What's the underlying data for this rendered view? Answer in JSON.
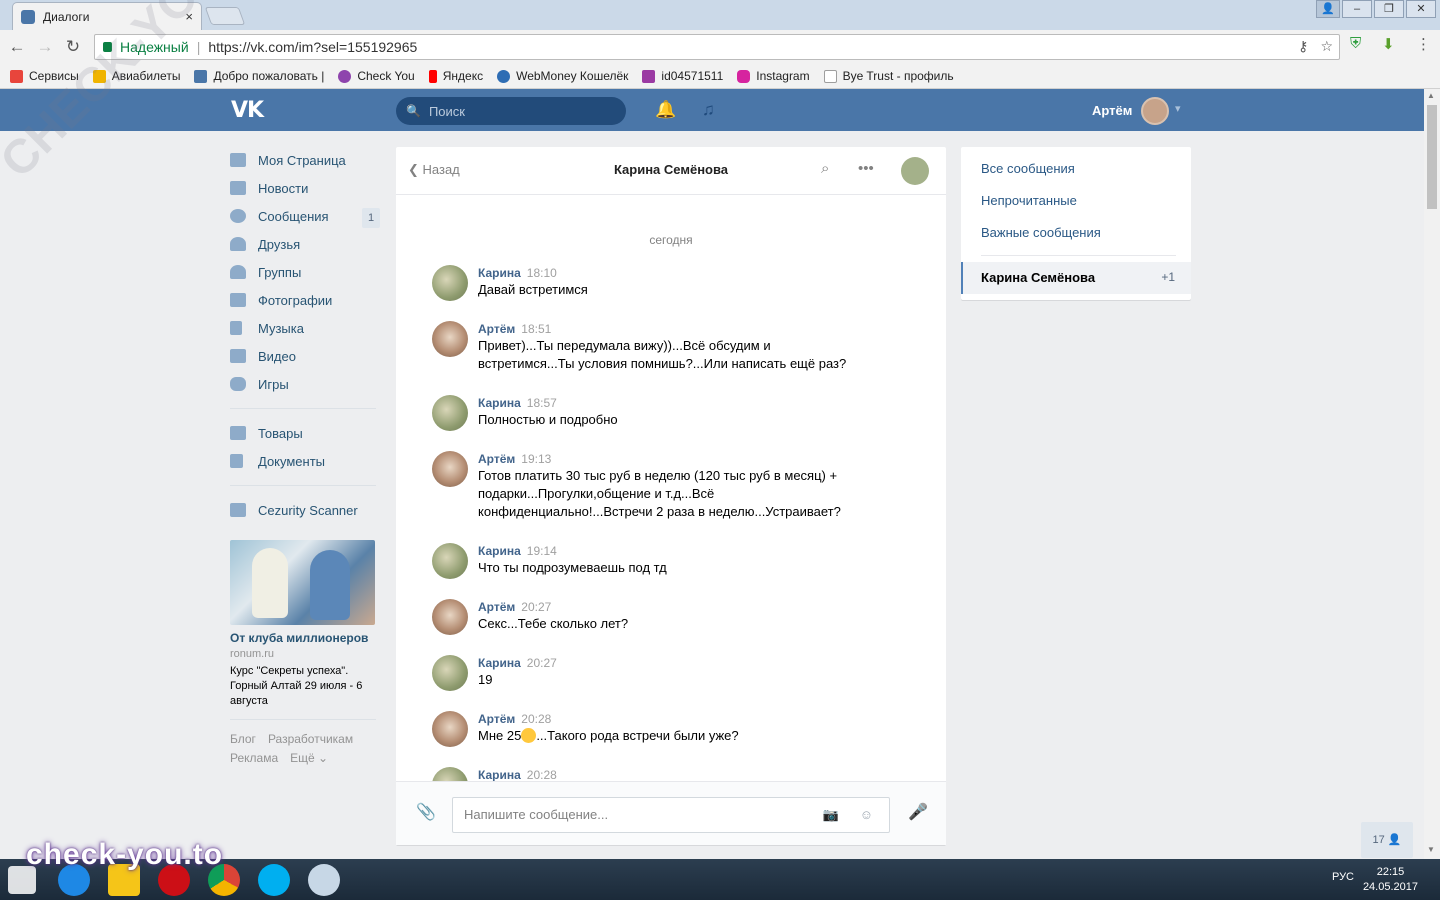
{
  "browser": {
    "tab_title": "Диалоги",
    "tab_close": "×",
    "secure_label": "Надежный",
    "url": "https://vk.com/im?sel=155192965",
    "window_buttons": [
      "–",
      "❐",
      "✕"
    ],
    "user_button": "👤"
  },
  "bookmarks": [
    {
      "label": "Сервисы",
      "color": "#e8453c"
    },
    {
      "label": "Авиабилеты",
      "color": "#f0b400"
    },
    {
      "label": "Добро пожаловать |",
      "color": "#4a76a8"
    },
    {
      "label": "Check You",
      "color": "#8e44ad"
    },
    {
      "label": "Яндекс",
      "color": "#ff0000"
    },
    {
      "label": "WebMoney Кошелёк",
      "color": "#2e6db4"
    },
    {
      "label": "id04571511",
      "color": "#9b3aa3"
    },
    {
      "label": "Instagram",
      "color": "#d6249f"
    },
    {
      "label": "Bye Trust - профиль",
      "color": "#9e9e9e"
    }
  ],
  "header": {
    "logo": "VK",
    "search_placeholder": "Поиск",
    "user_name": "Артём"
  },
  "menu": {
    "items": [
      {
        "label": "Моя Страница"
      },
      {
        "label": "Новости"
      },
      {
        "label": "Сообщения",
        "badge": "1"
      },
      {
        "label": "Друзья"
      },
      {
        "label": "Группы"
      },
      {
        "label": "Фотографии"
      },
      {
        "label": "Музыка"
      },
      {
        "label": "Видео"
      },
      {
        "label": "Игры"
      }
    ],
    "items2": [
      {
        "label": "Товары"
      },
      {
        "label": "Документы"
      }
    ],
    "items3": [
      {
        "label": "Cezurity Scanner"
      }
    ],
    "ad": {
      "title": "От клуба миллионеров",
      "site": "ronum.ru",
      "text": "Курс \"Секреты успеха\". Горный Алтай 29 июля - 6 августа"
    },
    "footer": [
      "Блог",
      "Разработчикам",
      "Реклама",
      "Ещё ⌄"
    ]
  },
  "chat": {
    "back_label": "Назад",
    "name": "Карина Семёнова",
    "date_label": "сегодня",
    "messages": [
      {
        "author": "Карина",
        "time": "18:10",
        "text": "Давай встретимся",
        "who": "k"
      },
      {
        "author": "Артём",
        "time": "18:51",
        "text": "Привет)...Ты передумала вижу))...Всё обсудим и встретимся...Ты условия помнишь?...Или написать ещё раз?",
        "who": "a"
      },
      {
        "author": "Карина",
        "time": "18:57",
        "text": "Полностью и подробно",
        "who": "k"
      },
      {
        "author": "Артём",
        "time": "19:13",
        "text": "Готов платить 30 тыс руб в неделю (120 тыс руб в месяц) + подарки...Прогулки,общение и т.д...Всё конфиденциально!...Встречи 2 раза в неделю...Устраивает?",
        "who": "a"
      },
      {
        "author": "Карина",
        "time": "19:14",
        "text": "Что ты подрозумеваешь под тд",
        "who": "k"
      },
      {
        "author": "Артём",
        "time": "20:27",
        "text": "Секс...Тебе сколько лет?",
        "who": "a"
      },
      {
        "author": "Карина",
        "time": "20:27",
        "text": "19",
        "who": "k"
      },
      {
        "author": "Артём",
        "time": "20:28",
        "text_before": "Мне 25",
        "text_after": "...Такого рода встречи были уже?",
        "who": "a"
      },
      {
        "author": "Карина",
        "time": "20:28",
        "text": "",
        "who": "k"
      }
    ],
    "composer_placeholder": "Напишите сообщение..."
  },
  "right_panel": {
    "links": [
      "Все сообщения",
      "Непрочитанные",
      "Важные сообщения"
    ],
    "active_name": "Карина Семёнова",
    "active_count": "+1"
  },
  "online_count": "17",
  "taskbar": {
    "lang": "РУС",
    "time": "22:15",
    "date": "24.05.2017",
    "watermark": "check-you.to",
    "diagonal_watermark": "CHECK-YOU.ME"
  }
}
